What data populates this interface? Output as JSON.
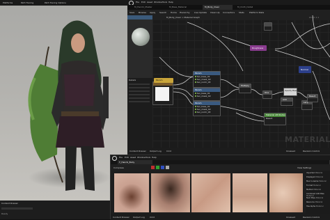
{
  "left_viewport": {
    "tabs": [
      "Platforms",
      "Path Tracing",
      "Path Tracing Options"
    ],
    "bottom_label": "Content Drawer",
    "bottom_status": "Ready"
  },
  "material_editor": {
    "menu": [
      "File",
      "Edit",
      "Asset",
      "Window",
      "Tools",
      "Help"
    ],
    "doc_tabs": [
      "M_Henrik_Master",
      "M_Base_Material",
      "M_Body_Clear",
      "M_Cloth_Detail"
    ],
    "toolbar": [
      "Save",
      "Browse",
      "Apply",
      "Search",
      "Home",
      "Hierarchy",
      "Live Update",
      "Clean Up",
      "Connectors",
      "Stats",
      "Platform Stats"
    ],
    "breadcrumb": "M_Body_Clear > Material Graph",
    "zoom": "Zoom 1:1",
    "watermark": "MATERIAL",
    "bottom": [
      "Content Drawer",
      "Output Log",
      "Cmd"
    ],
    "status": [
      "Unsaved",
      "Revision Control"
    ],
    "details_title": "Details",
    "nodes": {
      "param_top": "Roughness",
      "param_right": "Normal",
      "param_yellow": "Param",
      "tex1_title": "Param",
      "tex1_rows": [
        "tex_base_01",
        "tex_mask_02",
        "tex_norm_03"
      ],
      "tex2_title": "Param",
      "tex2_rows": [
        "tex_base_01",
        "tex_mask_02"
      ],
      "tex3_title": "Param",
      "tex3_rows": [
        "tex_base_01",
        "tex_mask_02",
        "tex_norm_03"
      ],
      "mult_title": "Multiply",
      "opacity": "Opacity Mask",
      "green_title": "Material Attributes",
      "green_sub": "Result",
      "small": [
        "One",
        "Add",
        "Lerp",
        "Result"
      ]
    }
  },
  "texture_editor": {
    "title": "T_Henrik_Body",
    "menu": [
      "File",
      "Edit",
      "Asset",
      "Window",
      "Tools",
      "Help"
    ],
    "channels": [
      "R",
      "G",
      "B",
      "A"
    ],
    "color_values": [
      "#c03030",
      "#30a030",
      "#3050c0",
      "#aaaaaa"
    ],
    "toolbar_label": "Compress",
    "view_label": "View Settings",
    "bottom": [
      "Content Drawer",
      "Output Log",
      "Cmd"
    ],
    "status": [
      "Unsaved",
      "Revision Control"
    ],
    "details": [
      {
        "k": "Imported",
        "v": "Material"
      },
      {
        "k": "Displayed",
        "v": "Material"
      },
      {
        "k": "Max In-Game",
        "v": "Material"
      },
      {
        "k": "Format",
        "v": "Material"
      },
      {
        "k": "Method",
        "v": "Material"
      },
      {
        "k": "Combined LOD Bias",
        "v": "Material"
      },
      {
        "k": "Num Mips",
        "v": "Material"
      },
      {
        "k": "Resource",
        "v": "Material"
      },
      {
        "k": "Has Alpha",
        "v": "Material"
      }
    ]
  }
}
